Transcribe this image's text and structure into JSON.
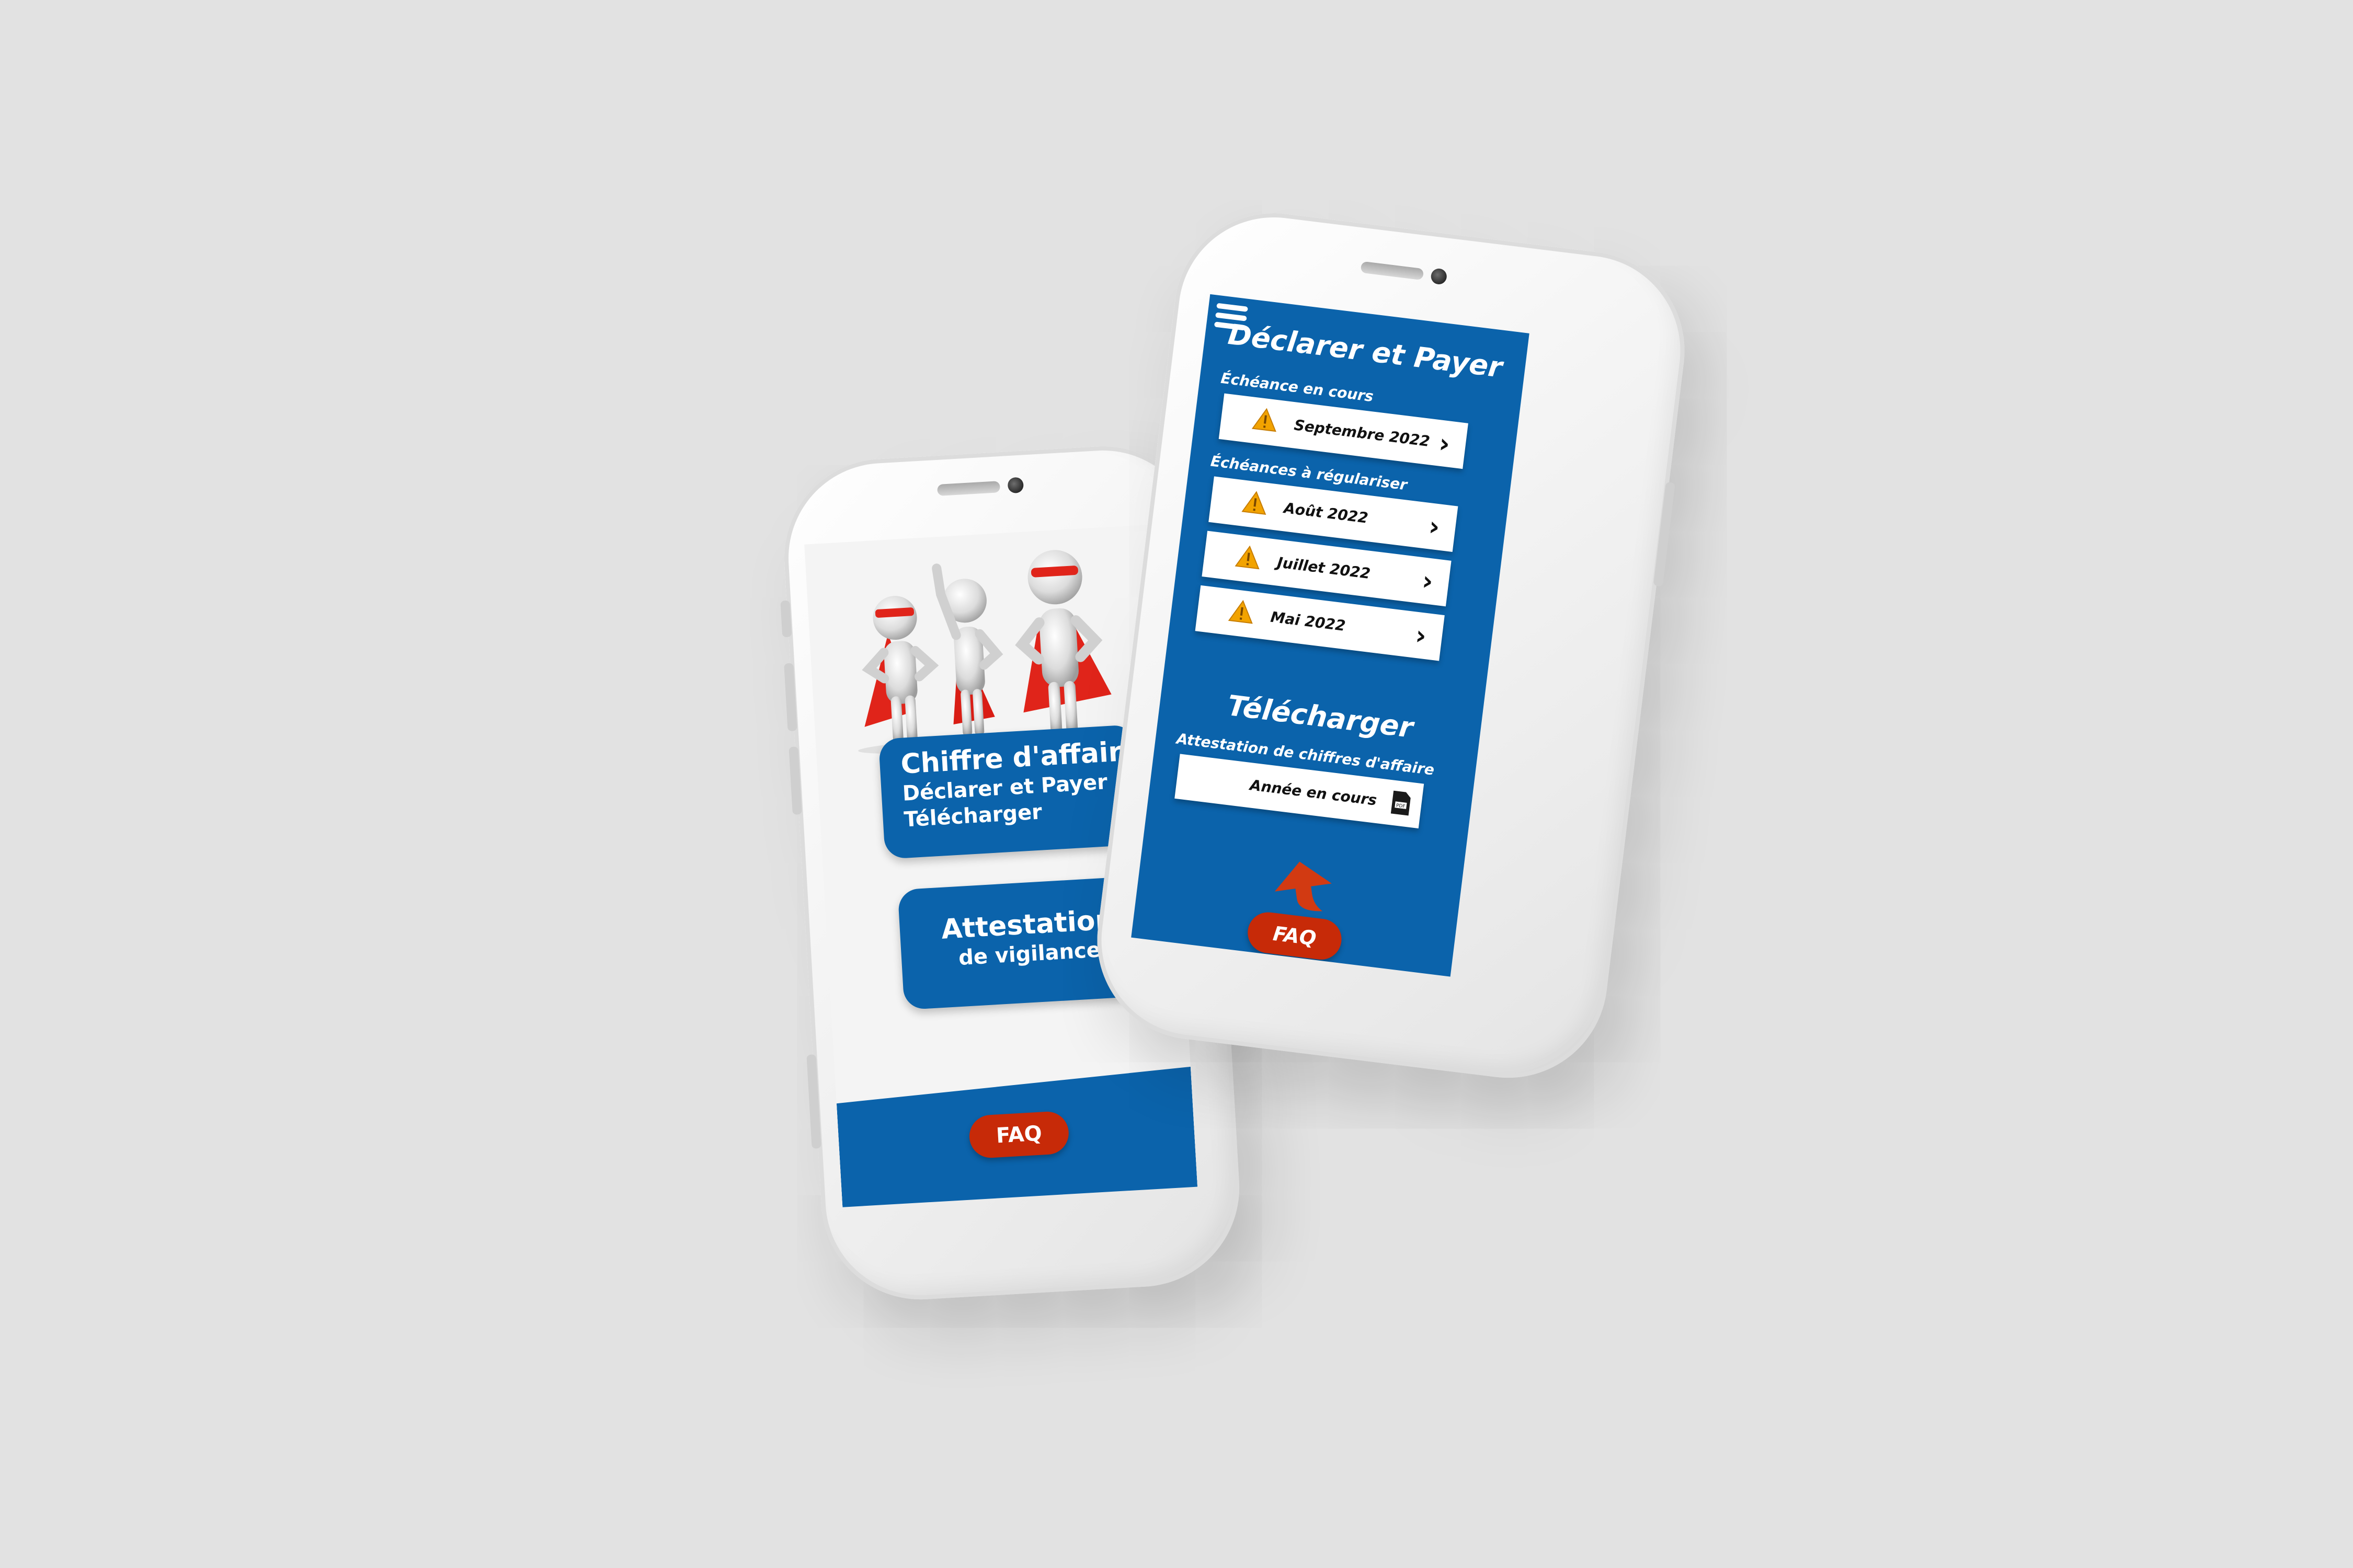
{
  "left_phone": {
    "card_ca": {
      "title": "Chiffre d'affaire",
      "line2": "Déclarer et Payer",
      "line3": "Télécharger"
    },
    "card_attestation": {
      "title": "Attestation",
      "line2": "de vigilance"
    },
    "faq_label": "FAQ"
  },
  "right_phone": {
    "title": "Déclarer et Payer",
    "section_current": "Échéance en cours",
    "current_items": [
      {
        "label": "Septembre 2022",
        "icon": "warning-icon"
      }
    ],
    "section_regularize": "Échéances à régulariser",
    "regularize_items": [
      {
        "label": "Août 2022",
        "icon": "warning-icon"
      },
      {
        "label": "Juillet 2022",
        "icon": "warning-icon"
      },
      {
        "label": "Mai 2022",
        "icon": "warning-icon"
      }
    ],
    "download_title": "Télécharger",
    "download_section": "Attestation de chiffres d'affaire",
    "download_item": {
      "label": "Année en cours",
      "icon": "pdf-icon"
    },
    "faq_label": "FAQ"
  },
  "colors": {
    "background": "#e2e2e2",
    "brand_blue": "#0b63ab",
    "accent_red": "#c72a08",
    "warning_orange": "#f2a300"
  }
}
